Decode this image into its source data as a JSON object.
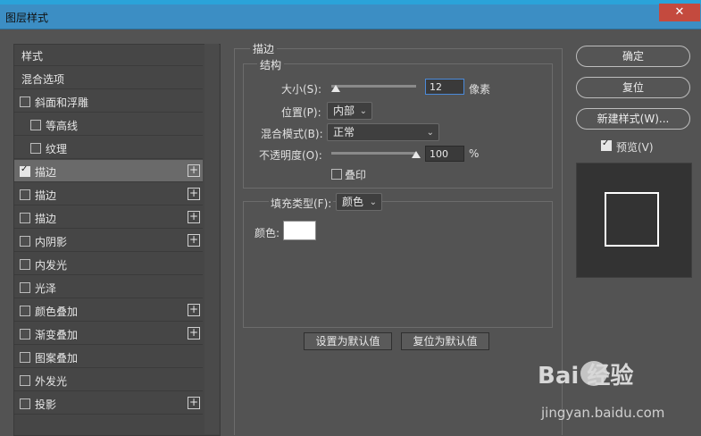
{
  "window": {
    "title": "图层样式",
    "close_glyph": "✕"
  },
  "left_panel": {
    "header": "样式",
    "items": [
      {
        "label": "混合选项",
        "checkbox": false,
        "checked": false,
        "plus": false,
        "indent": false
      },
      {
        "label": "斜面和浮雕",
        "checkbox": true,
        "checked": false,
        "plus": false,
        "indent": false
      },
      {
        "label": "等高线",
        "checkbox": true,
        "checked": false,
        "plus": false,
        "indent": true
      },
      {
        "label": "纹理",
        "checkbox": true,
        "checked": false,
        "plus": false,
        "indent": true
      },
      {
        "label": "描边",
        "checkbox": true,
        "checked": true,
        "plus": true,
        "indent": false,
        "selected": true
      },
      {
        "label": "描边",
        "checkbox": true,
        "checked": false,
        "plus": true,
        "indent": false
      },
      {
        "label": "描边",
        "checkbox": true,
        "checked": false,
        "plus": true,
        "indent": false
      },
      {
        "label": "内阴影",
        "checkbox": true,
        "checked": false,
        "plus": true,
        "indent": false
      },
      {
        "label": "内发光",
        "checkbox": true,
        "checked": false,
        "plus": false,
        "indent": false
      },
      {
        "label": "光泽",
        "checkbox": true,
        "checked": false,
        "plus": false,
        "indent": false
      },
      {
        "label": "颜色叠加",
        "checkbox": true,
        "checked": false,
        "plus": true,
        "indent": false
      },
      {
        "label": "渐变叠加",
        "checkbox": true,
        "checked": false,
        "plus": true,
        "indent": false
      },
      {
        "label": "图案叠加",
        "checkbox": true,
        "checked": false,
        "plus": false,
        "indent": false
      },
      {
        "label": "外发光",
        "checkbox": true,
        "checked": false,
        "plus": false,
        "indent": false
      },
      {
        "label": "投影",
        "checkbox": true,
        "checked": false,
        "plus": true,
        "indent": false
      }
    ],
    "plus_glyph": "+"
  },
  "stroke": {
    "section_title": "描边",
    "structure_title": "结构",
    "size_label": "大小(S):",
    "size_value": "12",
    "size_unit": "像素",
    "size_slider_level": 0.05,
    "position_label": "位置(P):",
    "position_value": "内部",
    "blend_label": "混合模式(B):",
    "blend_value": "正常",
    "opacity_label": "不透明度(O):",
    "opacity_value": "100",
    "opacity_unit": "%",
    "opacity_slider_level": 1.0,
    "overprint_label": "叠印",
    "fill_type_label": "填充类型(F):",
    "fill_type_value": "颜色",
    "color_label": "颜色:",
    "color_value": "#ffffff",
    "set_default_button": "设置为默认值",
    "reset_default_button": "复位为默认值",
    "chevron_glyph": "⌄"
  },
  "right_panel": {
    "ok_button": "确定",
    "reset_button": "复位",
    "new_style_button": "新建样式(W)...",
    "preview_label": "预览(V)",
    "preview_checked": true
  },
  "watermark": {
    "brand": "Bai 经验",
    "url": "jingyan.baidu.com"
  },
  "colors": {
    "accent_blue": "#4b8ad9",
    "titlebar": "#3c8ec4",
    "panel": "#535353",
    "close": "#c44a3e"
  }
}
